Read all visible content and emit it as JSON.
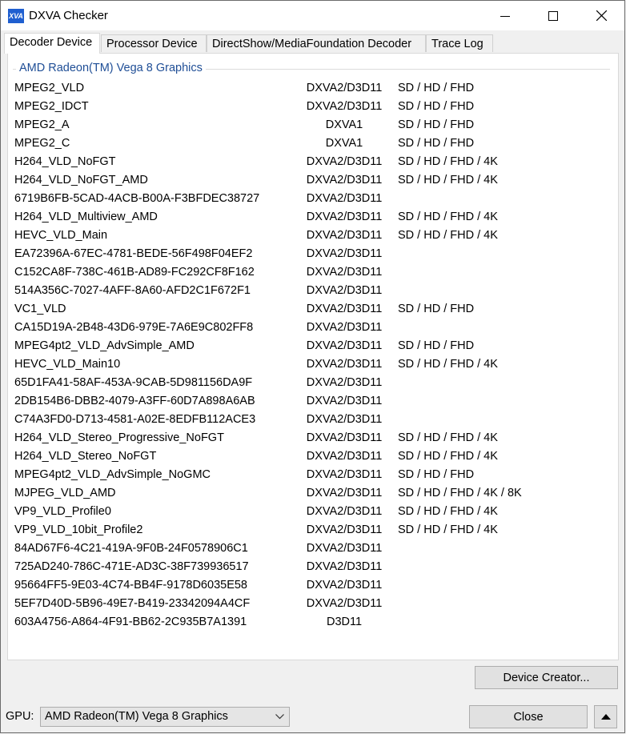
{
  "window": {
    "title": "DXVA Checker",
    "icon_text": "XVA"
  },
  "tabs": [
    {
      "label": "Decoder Device",
      "active": true
    },
    {
      "label": "Processor Device",
      "active": false
    },
    {
      "label": "DirectShow/MediaFoundation Decoder",
      "active": false
    },
    {
      "label": "Trace Log",
      "active": false
    }
  ],
  "group": {
    "label": "AMD Radeon(TM) Vega 8 Graphics"
  },
  "decoders": [
    {
      "name": "MPEG2_VLD",
      "api": "DXVA2/D3D11",
      "res": "SD / HD / FHD"
    },
    {
      "name": "MPEG2_IDCT",
      "api": "DXVA2/D3D11",
      "res": "SD / HD / FHD"
    },
    {
      "name": "MPEG2_A",
      "api": "DXVA1",
      "res": "SD / HD / FHD"
    },
    {
      "name": "MPEG2_C",
      "api": "DXVA1",
      "res": "SD / HD / FHD"
    },
    {
      "name": "H264_VLD_NoFGT",
      "api": "DXVA2/D3D11",
      "res": "SD / HD / FHD / 4K"
    },
    {
      "name": "H264_VLD_NoFGT_AMD",
      "api": "DXVA2/D3D11",
      "res": "SD / HD / FHD / 4K"
    },
    {
      "name": "6719B6FB-5CAD-4ACB-B00A-F3BFDEC38727",
      "api": "DXVA2/D3D11",
      "res": ""
    },
    {
      "name": "H264_VLD_Multiview_AMD",
      "api": "DXVA2/D3D11",
      "res": "SD / HD / FHD / 4K"
    },
    {
      "name": "HEVC_VLD_Main",
      "api": "DXVA2/D3D11",
      "res": "SD / HD / FHD / 4K"
    },
    {
      "name": "EA72396A-67EC-4781-BEDE-56F498F04EF2",
      "api": "DXVA2/D3D11",
      "res": ""
    },
    {
      "name": "C152CA8F-738C-461B-AD89-FC292CF8F162",
      "api": "DXVA2/D3D11",
      "res": ""
    },
    {
      "name": "514A356C-7027-4AFF-8A60-AFD2C1F672F1",
      "api": "DXVA2/D3D11",
      "res": ""
    },
    {
      "name": "VC1_VLD",
      "api": "DXVA2/D3D11",
      "res": "SD / HD / FHD"
    },
    {
      "name": "CA15D19A-2B48-43D6-979E-7A6E9C802FF8",
      "api": "DXVA2/D3D11",
      "res": ""
    },
    {
      "name": "MPEG4pt2_VLD_AdvSimple_AMD",
      "api": "DXVA2/D3D11",
      "res": "SD / HD / FHD"
    },
    {
      "name": "HEVC_VLD_Main10",
      "api": "DXVA2/D3D11",
      "res": "SD / HD / FHD / 4K"
    },
    {
      "name": "65D1FA41-58AF-453A-9CAB-5D981156DA9F",
      "api": "DXVA2/D3D11",
      "res": ""
    },
    {
      "name": "2DB154B6-DBB2-4079-A3FF-60D7A898A6AB",
      "api": "DXVA2/D3D11",
      "res": ""
    },
    {
      "name": "C74A3FD0-D713-4581-A02E-8EDFB112ACE3",
      "api": "DXVA2/D3D11",
      "res": ""
    },
    {
      "name": "H264_VLD_Stereo_Progressive_NoFGT",
      "api": "DXVA2/D3D11",
      "res": "SD / HD / FHD / 4K"
    },
    {
      "name": "H264_VLD_Stereo_NoFGT",
      "api": "DXVA2/D3D11",
      "res": "SD / HD / FHD / 4K"
    },
    {
      "name": "MPEG4pt2_VLD_AdvSimple_NoGMC",
      "api": "DXVA2/D3D11",
      "res": "SD / HD / FHD"
    },
    {
      "name": "MJPEG_VLD_AMD",
      "api": "DXVA2/D3D11",
      "res": "SD / HD / FHD / 4K / 8K"
    },
    {
      "name": "VP9_VLD_Profile0",
      "api": "DXVA2/D3D11",
      "res": "SD / HD / FHD / 4K"
    },
    {
      "name": "VP9_VLD_10bit_Profile2",
      "api": "DXVA2/D3D11",
      "res": "SD / HD / FHD / 4K"
    },
    {
      "name": "84AD67F6-4C21-419A-9F0B-24F0578906C1",
      "api": "DXVA2/D3D11",
      "res": ""
    },
    {
      "name": "725AD240-786C-471E-AD3C-38F739936517",
      "api": "DXVA2/D3D11",
      "res": ""
    },
    {
      "name": "95664FF5-9E03-4C74-BB4F-9178D6035E58",
      "api": "DXVA2/D3D11",
      "res": ""
    },
    {
      "name": "5EF7D40D-5B96-49E7-B419-23342094A4CF",
      "api": "DXVA2/D3D11",
      "res": ""
    },
    {
      "name": "603A4756-A864-4F91-BB62-2C935B7A1391",
      "api": "D3D11",
      "res": ""
    }
  ],
  "buttons": {
    "device_creator": "Device Creator...",
    "close": "Close"
  },
  "gpu": {
    "label": "GPU:",
    "selected": "AMD Radeon(TM) Vega 8 Graphics"
  },
  "colors": {
    "group_label": "#1f4e96",
    "icon_bg": "#1f5fd0"
  },
  "icons": {
    "minimize": "minimize-icon",
    "maximize": "maximize-icon",
    "close": "close-icon",
    "dropdown": "chevron-down-icon",
    "up": "triangle-up-icon"
  }
}
